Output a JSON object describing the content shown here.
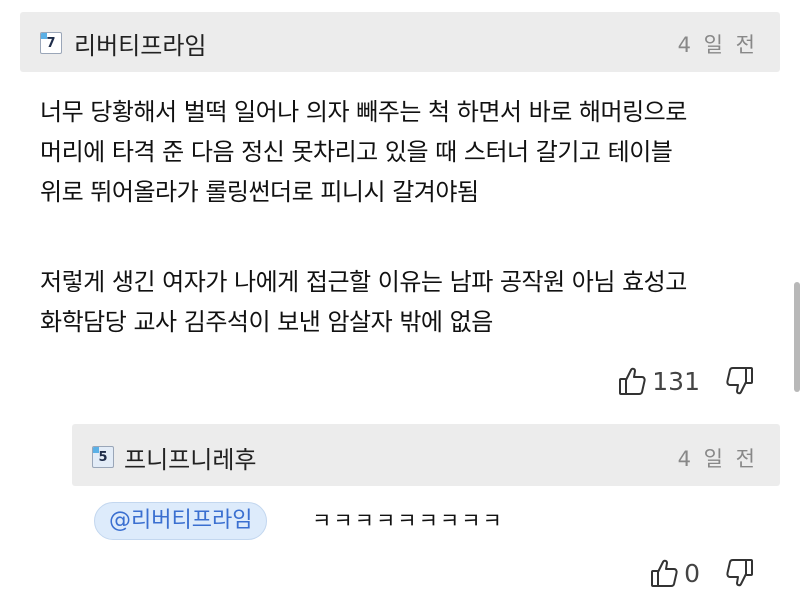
{
  "comment": {
    "user_level": "7",
    "username": "리버티프라임",
    "timestamp": "4 일 전",
    "body_lines": [
      "너무 당황해서 벌떡 일어나 의자 빼주는 척 하면서 바로 해머링으로",
      "머리에 타격 준 다음 정신 못차리고 있을 때 스터너 갈기고 테이블",
      "위로 뛰어올라가 롤링썬더로 피니시 갈겨야됨",
      "저렇게 생긴 여자가 나에게 접근할 이유는 남파 공작원 아님 효성고",
      "화학담당 교사 김주석이 보낸 암살자 밖에 없음"
    ],
    "like_count": "131"
  },
  "reply": {
    "user_level": "5",
    "username": "프니프니레후",
    "timestamp": "4 일 전",
    "mention": "@리버티프라임",
    "text": "ㅋㅋㅋㅋㅋㅋㅋㅋㅋ",
    "like_count": "0"
  },
  "icons": {
    "like": "thumbs-up-icon",
    "dislike": "thumbs-down-icon"
  },
  "colors": {
    "header_bg": "#ececec",
    "mention_bg": "#ddebfb",
    "mention_text": "#3a6fd0",
    "badge_accent": "#5bb0e6"
  }
}
